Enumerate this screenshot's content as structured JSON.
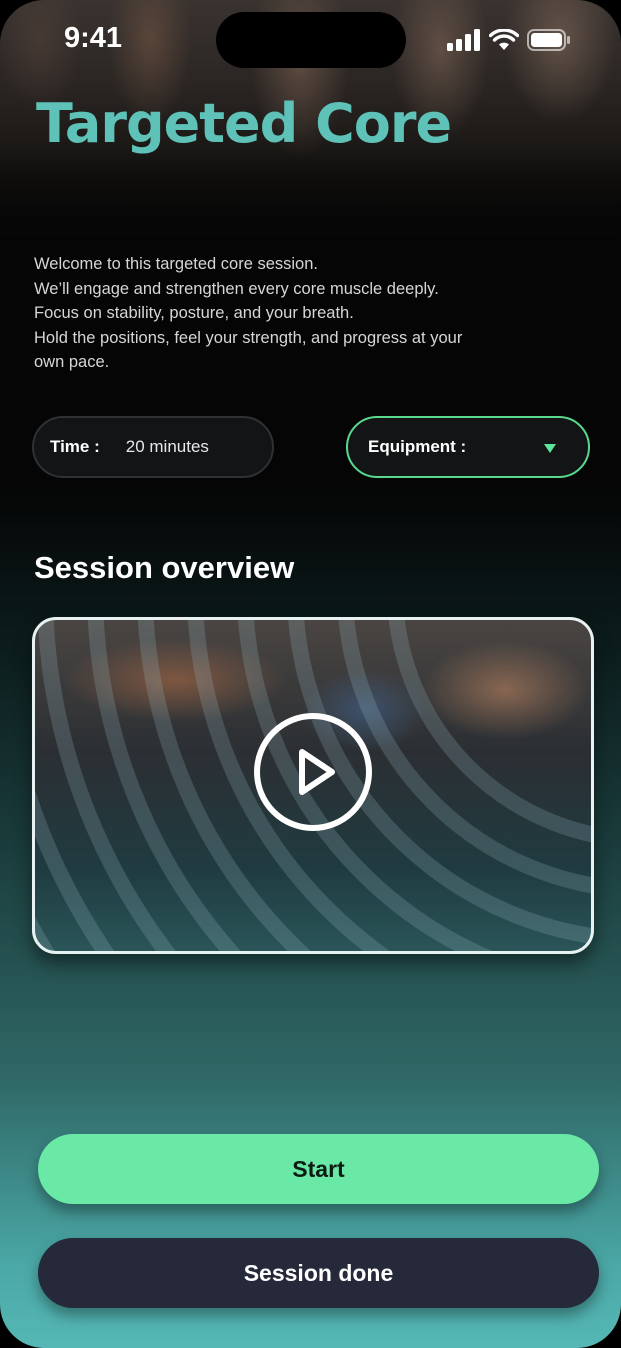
{
  "status_bar": {
    "time": "9:41",
    "icons": [
      "cellular-signal-icon",
      "wifi-icon",
      "battery-icon"
    ]
  },
  "header": {
    "title": "Targeted Core",
    "title_color": "#5ec2b8"
  },
  "intro": {
    "lines": [
      "Welcome to this targeted core session.",
      "We’ll engage and strengthen every core muscle deeply.",
      "Focus on stability, posture, and your breath.",
      "Hold the positions, feel your strength, and progress at your",
      "own pace."
    ]
  },
  "filters": {
    "time_label": "Time :",
    "time_value": "20 minutes",
    "equipment_label": "Equipment :",
    "equipment_value": "",
    "equipment_accent": "#59d98e"
  },
  "overview": {
    "title": "Session overview",
    "video_icon": "play-icon"
  },
  "actions": {
    "start_label": "Start",
    "start_color": "#69e8a6",
    "done_label": "Session done",
    "done_color": "#252939"
  }
}
